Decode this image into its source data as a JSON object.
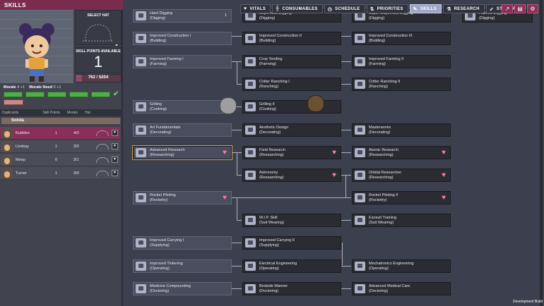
{
  "panel": {
    "title": "SKILLS",
    "select_hat": "SELECT HAT",
    "skill_points_label": "SKILL POINTS AVAILABLE",
    "skill_points": "1",
    "xp": "762 / 5204",
    "xp_fraction": 0.146,
    "morale_text": "Morale",
    "morale_value": "4",
    "morale_delta": "+1",
    "morale_need_text": "Morale Need",
    "morale_need_value": "0",
    "morale_need_delta": "+1",
    "sort": [
      "Duplicants",
      "Skill Points",
      "Morale",
      "Hat"
    ],
    "group": "Solola",
    "duplicants": [
      {
        "name": "Bubbles",
        "c1": "1",
        "c2": "4/0"
      },
      {
        "name": "Lindsay",
        "c1": "1",
        "c2": "3/0"
      },
      {
        "name": "Meep",
        "c1": "0",
        "c2": "3/1"
      },
      {
        "name": "Turner",
        "c1": "1",
        "c2": "3/0"
      }
    ]
  },
  "tabs": [
    {
      "label": "VITALS",
      "icon": "heart-icon"
    },
    {
      "label": "CONSUMABLES",
      "icon": "fork-knife-icon"
    },
    {
      "label": "SCHEDULE",
      "icon": "clock-icon"
    },
    {
      "label": "PRIORITIES",
      "icon": "arrows-icon"
    },
    {
      "label": "SKILLS",
      "icon": "wrench-icon"
    },
    {
      "label": "RESEARCH",
      "icon": "flask-icon"
    },
    {
      "label": "STARMAP",
      "icon": "rocket-icon"
    }
  ],
  "skills": [
    {
      "name": "Hard Digging",
      "cat": "(Digging)",
      "extra": "1"
    },
    {
      "name": "Superhard Digging",
      "cat": "(Digging)"
    },
    {
      "name": "Super-Duperhard Digging",
      "cat": "(Digging)"
    },
    {
      "name": "Hazmat Digging",
      "cat": "(Digging)"
    },
    {
      "name": "Improved Construction I",
      "cat": "(Building)"
    },
    {
      "name": "Improved Construction II",
      "cat": "(Building)"
    },
    {
      "name": "Improved Construction III",
      "cat": "(Building)"
    },
    {
      "name": "Improved Farming I",
      "cat": "(Farming)"
    },
    {
      "name": "Crop Tending",
      "cat": "(Farming)"
    },
    {
      "name": "Improved Farming II",
      "cat": "(Farming)"
    },
    {
      "name": "Critter Ranching I",
      "cat": "(Ranching)"
    },
    {
      "name": "Critter Ranching II",
      "cat": "(Ranching)"
    },
    {
      "name": "Grilling",
      "cat": "(Cooking)"
    },
    {
      "name": "Grilling II",
      "cat": "(Cooking)"
    },
    {
      "name": "Art Fundamentals",
      "cat": "(Decorating)"
    },
    {
      "name": "Aesthetic Design",
      "cat": "(Decorating)"
    },
    {
      "name": "Masterworks",
      "cat": "(Decorating)"
    },
    {
      "name": "Advanced Research",
      "cat": "(Researching)"
    },
    {
      "name": "Field Research",
      "cat": "(Researching)"
    },
    {
      "name": "Atomic Research",
      "cat": "(Researching)"
    },
    {
      "name": "Astronomy",
      "cat": "(Researching)"
    },
    {
      "name": "Orbital Researcher",
      "cat": "(Researching)"
    },
    {
      "name": "Rocket Piloting",
      "cat": "(Rocketry)"
    },
    {
      "name": "Rocket Piloting II",
      "cat": "(Rocketry)"
    },
    {
      "name": "W.I.P. Skill",
      "cat": "(Suit Wearing)"
    },
    {
      "name": "Exosuit Training",
      "cat": "(Suit Wearing)"
    },
    {
      "name": "Improved Carrying I",
      "cat": "(Supplying)"
    },
    {
      "name": "Improved Carrying II",
      "cat": "(Supplying)"
    },
    {
      "name": "Improved Tinkering",
      "cat": "(Operating)"
    },
    {
      "name": "Electrical Engineering",
      "cat": "(Operating)"
    },
    {
      "name": "Mechatronics Engineering",
      "cat": "(Operating)"
    },
    {
      "name": "Medicine Compounding",
      "cat": "(Doctoring)"
    },
    {
      "name": "Bedside Manner",
      "cat": "(Doctoring)"
    },
    {
      "name": "Advanced Medical Care",
      "cat": "(Doctoring)"
    }
  ],
  "footer": "Development Build"
}
